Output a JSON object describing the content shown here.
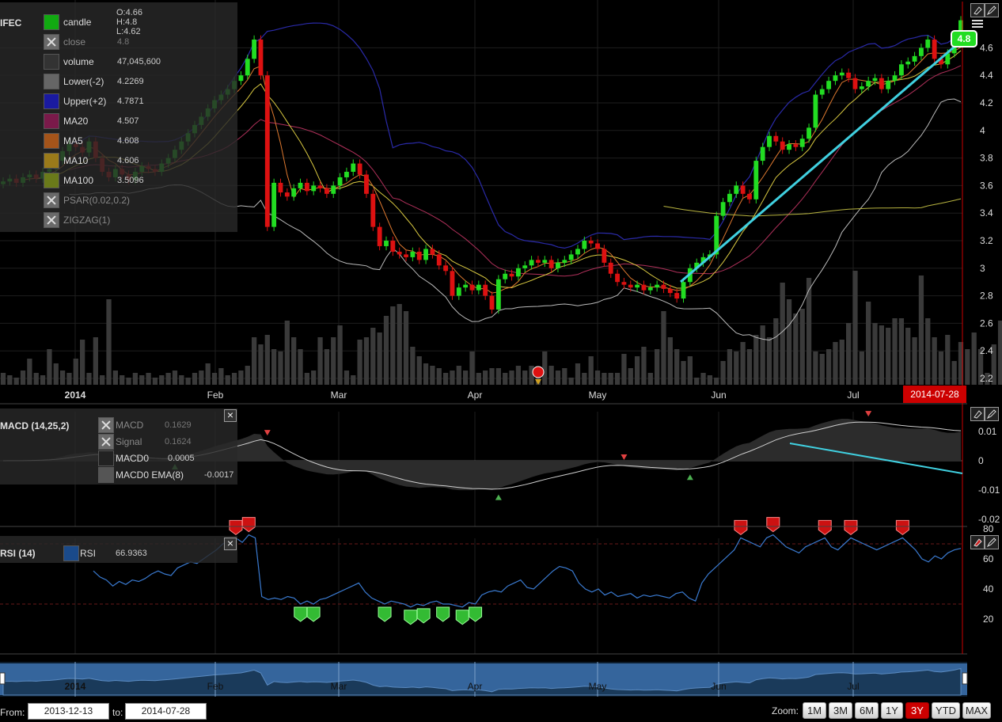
{
  "main_legend": {
    "symbol": "IFEC",
    "ohlc": {
      "open": "O:4.66",
      "high": "H:4.8",
      "low": "L:4.62"
    },
    "items": [
      {
        "label": "candle",
        "value": "",
        "color": "#11aa11",
        "disabled": false
      },
      {
        "label": "close",
        "value": "4.8",
        "color": "",
        "disabled": true
      },
      {
        "label": "volume",
        "value": "47,045,600",
        "color": "#333333",
        "disabled": false
      },
      {
        "label": "Lower(-2)",
        "value": "4.2269",
        "color": "#666666",
        "disabled": false
      },
      {
        "label": "Upper(+2)",
        "value": "4.7871",
        "color": "#1a1aa0",
        "disabled": false
      },
      {
        "label": "MA20",
        "value": "4.507",
        "color": "#7a1a4a",
        "disabled": false
      },
      {
        "label": "MA5",
        "value": "4.608",
        "color": "#a4541a",
        "disabled": false
      },
      {
        "label": "MA10",
        "value": "4.606",
        "color": "#9a7a1a",
        "disabled": false
      },
      {
        "label": "MA100",
        "value": "3.5096",
        "color": "#6a7a1a",
        "disabled": false
      },
      {
        "label": "PSAR(0.02,0.2)",
        "value": "",
        "color": "",
        "disabled": true
      },
      {
        "label": "ZIGZAG(1)",
        "value": "",
        "color": "",
        "disabled": true
      }
    ]
  },
  "macd_legend": {
    "title": "MACD (14,25,2)",
    "items": [
      {
        "label": "MACD",
        "value": "0.1629",
        "color": "",
        "disabled": true
      },
      {
        "label": "Signal",
        "value": "0.1624",
        "color": "",
        "disabled": true
      },
      {
        "label": "MACD0",
        "value": "0.0005",
        "color": "#222222",
        "disabled": false
      },
      {
        "label": "MACD0 EMA(8)",
        "value": "-0.0017",
        "color": "#555555",
        "disabled": false
      }
    ]
  },
  "rsi_legend": {
    "title": "RSI (14)",
    "items": [
      {
        "label": "RSI",
        "value": "66.9363",
        "color": "#1a4a8a",
        "disabled": false
      }
    ]
  },
  "price_axis": {
    "ticks": [
      "4.6",
      "4.4",
      "4.2",
      "4",
      "3.8",
      "3.6",
      "3.4",
      "3.2",
      "3",
      "2.8",
      "2.6",
      "2.4",
      "2.2"
    ]
  },
  "macd_axis": {
    "ticks": [
      "0.01",
      "0",
      "-0.01",
      "-0.02"
    ]
  },
  "rsi_axis": {
    "ticks": [
      "80",
      "60",
      "40",
      "20"
    ]
  },
  "time_axis": {
    "labels": [
      "2014",
      "Feb",
      "Mar",
      "Apr",
      "May",
      "Jun",
      "Jul"
    ]
  },
  "navigator_axis": {
    "labels": [
      "2014",
      "Feb",
      "Mar",
      "Apr",
      "May",
      "Jun",
      "Jul"
    ]
  },
  "last_price": "4.8",
  "last_date": "2014-07-28",
  "bottom_bar": {
    "from_label": "From:",
    "from_value": "2013-12-13",
    "to_label": "to:",
    "to_value": "2014-07-28",
    "zoom_label": "Zoom:",
    "zoom_buttons": [
      "1M",
      "3M",
      "6M",
      "1Y",
      "3Y",
      "YTD",
      "MAX"
    ],
    "zoom_active": "3Y"
  },
  "colors": {
    "up": "#22dd22",
    "down": "#dd1111",
    "upper_band": "#2a2aa8",
    "lower_band": "#bbbbbb",
    "ma20": "#b0305a",
    "ma5": "#e07a30",
    "ma10": "#d8c840",
    "ma100": "#b8b440",
    "trendline": "#40d0e0",
    "rsi": "#3a7ad0",
    "navigator": "#3a6ea8"
  },
  "chart_data": {
    "type": "candlestick",
    "symbol": "IFEC",
    "x_range": [
      "2013-12-13",
      "2014-07-28"
    ],
    "ylim": [
      2.2,
      4.7
    ],
    "closes": [
      3.63,
      3.65,
      3.62,
      3.66,
      3.68,
      3.65,
      3.7,
      3.72,
      3.78,
      3.85,
      3.9,
      3.88,
      3.84,
      3.92,
      3.8,
      3.7,
      3.66,
      3.72,
      3.68,
      3.64,
      3.7,
      3.74,
      3.72,
      3.7,
      3.76,
      3.8,
      3.86,
      3.92,
      3.98,
      4.04,
      4.1,
      4.16,
      4.22,
      4.26,
      4.3,
      4.36,
      4.4,
      4.52,
      4.66,
      4.4,
      3.3,
      3.62,
      3.55,
      3.52,
      3.58,
      3.62,
      3.56,
      3.6,
      3.58,
      3.54,
      3.6,
      3.66,
      3.7,
      3.76,
      3.68,
      3.54,
      3.3,
      3.16,
      3.2,
      3.12,
      3.1,
      3.08,
      3.12,
      3.06,
      3.14,
      3.1,
      3.02,
      2.98,
      2.8,
      2.86,
      2.88,
      2.84,
      2.88,
      2.8,
      2.7,
      2.92,
      2.96,
      2.94,
      3.0,
      3.02,
      3.06,
      3.04,
      3.06,
      3.0,
      3.04,
      3.06,
      3.1,
      3.14,
      3.2,
      3.18,
      3.14,
      3.04,
      2.96,
      2.9,
      2.88,
      2.86,
      2.88,
      2.84,
      2.86,
      2.88,
      2.85,
      2.82,
      2.78,
      2.9,
      3.0,
      3.04,
      3.08,
      3.1,
      3.38,
      3.48,
      3.54,
      3.6,
      3.54,
      3.5,
      3.78,
      3.88,
      3.96,
      3.92,
      3.86,
      3.9,
      3.88,
      3.94,
      4.02,
      4.26,
      4.3,
      4.36,
      4.4,
      4.42,
      4.38,
      4.3,
      4.32,
      4.36,
      4.38,
      4.3,
      4.36,
      4.4,
      4.48,
      4.5,
      4.54,
      4.6,
      4.66,
      4.52,
      4.48,
      4.56,
      4.66,
      4.8
    ],
    "volume_relative": [
      0.1,
      0.08,
      0.06,
      0.12,
      0.22,
      0.1,
      0.08,
      0.3,
      0.18,
      0.12,
      0.1,
      0.22,
      0.38,
      0.1,
      0.4,
      0.08,
      0.72,
      0.12,
      0.08,
      0.06,
      0.1,
      0.08,
      0.1,
      0.06,
      0.08,
      0.1,
      0.12,
      0.08,
      0.06,
      0.1,
      0.12,
      0.18,
      0.1,
      0.14,
      0.08,
      0.1,
      0.12,
      0.16,
      0.4,
      0.34,
      0.42,
      0.3,
      0.28,
      0.54,
      0.4,
      0.3,
      0.1,
      0.12,
      0.4,
      0.3,
      0.4,
      0.5,
      0.12,
      0.08,
      0.38,
      0.4,
      0.48,
      0.44,
      0.58,
      0.66,
      0.68,
      0.62,
      0.32,
      0.24,
      0.18,
      0.16,
      0.14,
      0.1,
      0.12,
      0.16,
      0.12,
      0.28,
      0.1,
      0.12,
      0.14,
      0.14,
      0.1,
      0.12,
      0.16,
      0.12,
      0.16,
      0.1,
      0.28,
      0.16,
      0.12,
      0.14,
      0.06,
      0.18,
      0.1,
      0.24,
      0.12,
      0.1,
      0.1,
      0.1,
      0.26,
      0.14,
      0.24,
      0.32,
      0.1,
      0.3,
      0.62,
      0.4,
      0.3,
      0.2,
      0.24,
      0.06,
      0.1,
      0.08,
      0.06,
      0.2,
      0.3,
      0.28,
      0.36,
      0.3,
      0.42,
      0.5,
      0.4,
      0.56,
      0.86,
      0.72,
      0.6,
      0.64,
      0.9,
      0.28,
      0.26,
      0.3,
      0.36,
      0.38,
      0.52,
      0.96,
      0.28,
      0.7,
      0.52,
      0.5,
      0.48,
      0.56,
      0.56,
      0.48,
      0.4,
      0.92,
      0.56,
      0.4,
      0.28,
      0.42,
      0.2,
      0.36,
      0.3,
      0.44,
      0.3,
      0.1,
      0.34,
      0.54,
      0.36,
      0.7
    ],
    "rsi": [
      52,
      48,
      46,
      42,
      45,
      43,
      46,
      45,
      47,
      50,
      52,
      50,
      49,
      54,
      56,
      58,
      57,
      60,
      63,
      66,
      70,
      72,
      74,
      71,
      76,
      74,
      35,
      33,
      34,
      33,
      35,
      34,
      30,
      32,
      30,
      33,
      34,
      36,
      38,
      40,
      42,
      44,
      38,
      34,
      32,
      30,
      32,
      31,
      30,
      28,
      30,
      29,
      31,
      32,
      30,
      30,
      29,
      28,
      31,
      30,
      36,
      38,
      39,
      38,
      42,
      44,
      46,
      41,
      40,
      44,
      48,
      52,
      55,
      54,
      52,
      44,
      40,
      38,
      40,
      36,
      38,
      35,
      36,
      37,
      34,
      36,
      35,
      36,
      35,
      34,
      37,
      38,
      34,
      32,
      44,
      50,
      54,
      58,
      62,
      66,
      74,
      72,
      70,
      68,
      74,
      76,
      72,
      68,
      66,
      64,
      68,
      70,
      72,
      74,
      68,
      66,
      70,
      74,
      72,
      70,
      68,
      66,
      68,
      70,
      72,
      74,
      70,
      66,
      60,
      58,
      62,
      60,
      64,
      66,
      67
    ]
  }
}
